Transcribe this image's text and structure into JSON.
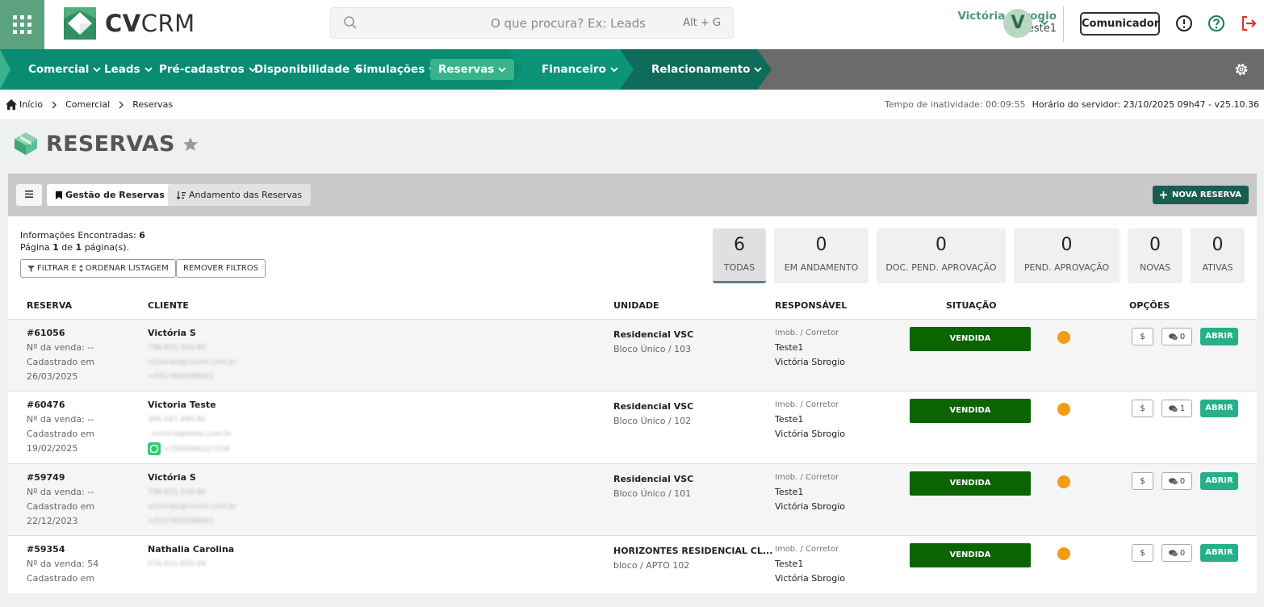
{
  "header": {
    "logo_bold": "CV",
    "logo_light": "CRM",
    "search_placeholder": "O que procura? Ex: Leads",
    "search_shortcut": "Alt + G",
    "user_name": "Victória Sbrogio",
    "user_login": "teste1",
    "avatar_initial": "V",
    "comunicador_label": "Comunicador"
  },
  "nav": {
    "items": [
      "Comercial",
      "Leads",
      "Pré-cadastros",
      "Disponibilidade",
      "Simulações",
      "Reservas"
    ],
    "active": "Reservas",
    "financeiro": "Financeiro",
    "relacionamento": "Relacionamento"
  },
  "breadcrumb": {
    "items": [
      "Início",
      "Comercial",
      "Reservas"
    ],
    "idle_label": "Tempo de inatividade: 00:09:55",
    "server_label": "Horário do servidor: 23/10/2025 09h47 - v25.10.36"
  },
  "page": {
    "title": "RESERVAS",
    "tab_active": "Gestão de Reservas",
    "tab_other": "Andamento das Reservas",
    "new_button": "NOVA RESERVA"
  },
  "info": {
    "found_label": "Informações Encontradas:",
    "found_count": "6",
    "page_prefix": "Página",
    "page_current": "1",
    "page_of": "de",
    "page_total": "1",
    "page_suffix": "página(s).",
    "filter_label": "FILTRAR E",
    "order_label": "ORDENAR LISTAGEM",
    "remove_filters": "REMOVER FILTROS"
  },
  "stats": [
    {
      "count": "6",
      "label": "TODAS"
    },
    {
      "count": "0",
      "label": "EM ANDAMENTO"
    },
    {
      "count": "0",
      "label": "DOC. PEND. APROVAÇÃO"
    },
    {
      "count": "0",
      "label": "PEND. APROVAÇÃO"
    },
    {
      "count": "0",
      "label": "NOVAS"
    },
    {
      "count": "0",
      "label": "ATIVAS"
    }
  ],
  "table": {
    "headers": [
      "RESERVA",
      "CLIENTE",
      "UNIDADE",
      "RESPONSÁVEL",
      "SITUAÇÃO",
      "OPÇÕES"
    ],
    "rows": [
      {
        "id": "#61056",
        "sale": "Nº da venda: --",
        "registered": "Cadastrado em",
        "date": "26/03/2025",
        "client": "Victória S",
        "doc": "796.631.330-80",
        "email": "victoriao@cvcrm.com.br",
        "phone": "+5517830388061",
        "unit": "Residencial VSC",
        "block": "Bloco Único / 103",
        "role": "Imob. / Corretor",
        "agency": "Teste1",
        "broker": "Victória Sbrogio",
        "status": "VENDIDA",
        "messages": "0",
        "open": "ABRIR"
      },
      {
        "id": "#60476",
        "sale": "Nº da venda: --",
        "registered": "Cadastrado em",
        "date": "19/02/2025",
        "client": "Victoria Teste",
        "doc": "366.047.490-80",
        "email": "_victoria@teste.com.br",
        "phone": "+5565986127336",
        "unit": "Residencial VSC",
        "block": "Bloco Único / 102",
        "role": "Imob. / Corretor",
        "agency": "Teste1",
        "broker": "Victória Sbrogio",
        "status": "VENDIDA",
        "messages": "1",
        "open": "ABRIR"
      },
      {
        "id": "#59749",
        "sale": "Nº da venda: --",
        "registered": "Cadastrado em",
        "date": "22/12/2023",
        "client": "Victória S",
        "doc": "796.631.330-80",
        "email": "victoriao@cvcrm.com.br",
        "phone": "+5517830388061",
        "unit": "Residencial VSC",
        "block": "Bloco Único / 101",
        "role": "Imob. / Corretor",
        "agency": "Teste1",
        "broker": "Victória Sbrogio",
        "status": "VENDIDA",
        "messages": "0",
        "open": "ABRIR"
      },
      {
        "id": "#59354",
        "sale": "Nº da venda: 54",
        "registered": "Cadastrado em",
        "date": "",
        "client": "Nathalia Carolina",
        "doc": "076.910.820-09",
        "email": "",
        "phone": "",
        "unit": "HORIZONTES RESIDENCIAL CL...",
        "block": "bloco / APTO 102",
        "role": "Imob. / Corretor",
        "agency": "Teste1",
        "broker": "Victória Sbrogio",
        "status": "VENDIDA",
        "messages": "0",
        "open": "ABRIR"
      }
    ]
  },
  "colors": {
    "brand_green": "#5ba37f",
    "nav_teal": "#0a8c72",
    "nav_dark_teal": "#0f6b5a",
    "nav_gray": "#6b6b6b",
    "active_tab": "#3ab38d",
    "vendida": "#0c6400",
    "status_dot": "#f39c12",
    "abrir": "#26b089",
    "new_button": "#185e4f"
  }
}
